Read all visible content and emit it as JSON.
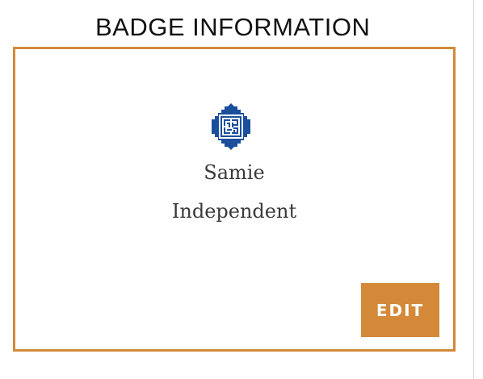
{
  "page": {
    "title": "BADGE INFORMATION"
  },
  "badge": {
    "logo_icon": "geometric-kufic-logo-icon",
    "name": "Samie",
    "type": "Independent",
    "edit_label": "EDIT"
  },
  "colors": {
    "accent": "#d38938",
    "logo_blue": "#1b4f9c",
    "text": "#3a3a3a"
  }
}
